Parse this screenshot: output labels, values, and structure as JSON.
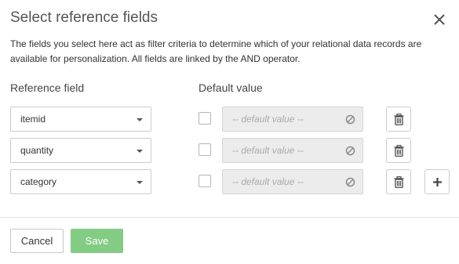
{
  "dialog": {
    "title": "Select reference fields",
    "description": "The fields you select here act as filter criteria to determine which of your relational data records are available for personalization. All fields are linked by the AND operator."
  },
  "columns": {
    "reference_field": "Reference field",
    "default_value": "Default value"
  },
  "rows": [
    {
      "field": "itemid",
      "checked": false,
      "default_placeholder": "-- default value --"
    },
    {
      "field": "quantity",
      "checked": false,
      "default_placeholder": "-- default value --"
    },
    {
      "field": "category",
      "checked": false,
      "default_placeholder": "-- default value --"
    }
  ],
  "footer": {
    "cancel_label": "Cancel",
    "save_label": "Save"
  },
  "icons": {
    "close": "close-icon",
    "dropdown": "chevron-down-icon",
    "clear": "no-entry-icon",
    "delete": "trash-icon",
    "add": "plus-icon"
  },
  "colors": {
    "save_button": "#82cc84",
    "disabled_field": "#ececec"
  }
}
